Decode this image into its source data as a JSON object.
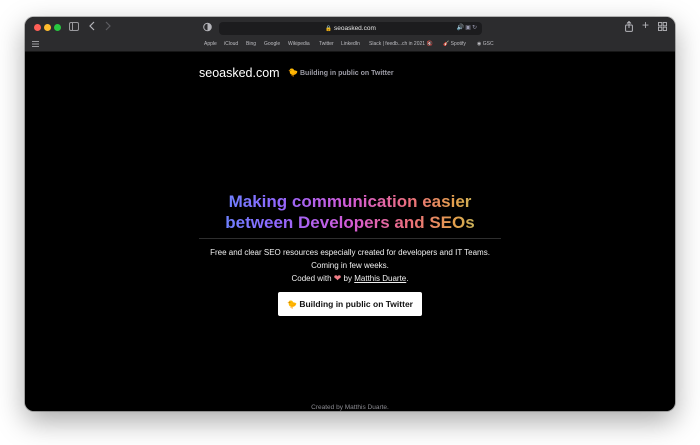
{
  "browser": {
    "url": "seoasked.com",
    "bookmarks": [
      "Apple",
      "iCloud",
      "Bing",
      "Google",
      "Wikipedia",
      "Twitter",
      "LinkedIn",
      "Slack | feedb...ch in 2021 🔇",
      "Spotify",
      "GSC"
    ],
    "colors": {
      "close": "#ff5f57",
      "minimize": "#febc2e",
      "zoom": "#28c840"
    },
    "icons": [
      "sidebar-icon",
      "back-icon",
      "forward-icon",
      "shield-icon",
      "lock-icon",
      "audio-icon",
      "translate-icon",
      "reload-icon",
      "share-icon",
      "new-tab-icon",
      "tab-overview-icon",
      "bookmarks-grid-icon"
    ]
  },
  "site": {
    "brand": "seoasked.com",
    "brand_link": "Building in public on Twitter",
    "headline_line1": "Making communication easier",
    "headline_line2": "between Developers and SEOs",
    "description": "Free and clear SEO resources especially created for developers and IT Teams.",
    "coming": "Coming in few weeks.",
    "coded_with": "Coded with",
    "by": "by",
    "author": "Matthis Duarte",
    "period": ".",
    "cta_label": "Building in public on Twitter",
    "footer": "Created by Matthis Duarte."
  }
}
